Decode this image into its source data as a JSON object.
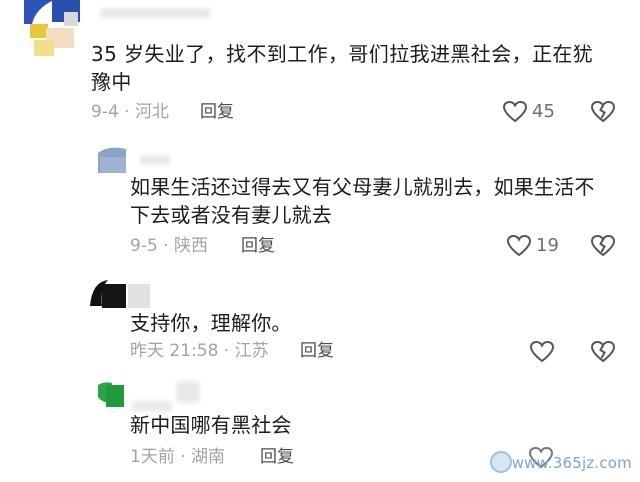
{
  "comments": [
    {
      "text": "35 岁失业了，找不到工作，哥们拉我进黑社会，正在犹豫中",
      "meta": "9-4 · 河北",
      "reply": "回复",
      "likes": "45"
    },
    {
      "text": "如果生活还过得去又有父母妻儿就别去，如果生活不下去或者没有妻儿就去",
      "meta": "9-5 · 陕西",
      "reply": "回复",
      "likes": "19"
    },
    {
      "text": "支持你，理解你。",
      "meta": "昨天 21:58 · 江苏",
      "reply": "回复",
      "likes": ""
    },
    {
      "text": "新中国哪有黑社会",
      "meta": "1天前 · 湖南",
      "reply": "回复",
      "likes": ""
    }
  ],
  "watermark": "www.365jz.com",
  "colors": {
    "text": "#1c1c1c",
    "meta": "#a3a3a3",
    "reply": "#4d4d4d",
    "icon": "#555555"
  },
  "icons": [
    "heart-outline-icon",
    "broken-heart-icon"
  ]
}
